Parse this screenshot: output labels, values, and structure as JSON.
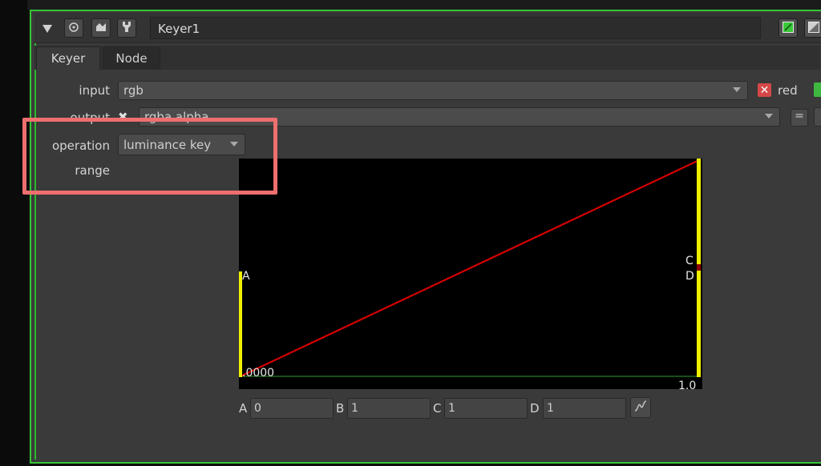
{
  "header": {
    "node_name": "Keyer1",
    "collapse_icon": "triangle-down-icon",
    "icons": [
      "center-node-icon",
      "clone-icon",
      "wrench-icon"
    ],
    "visibility_icons": [
      "green-square-icon",
      "split-square-icon"
    ]
  },
  "tabs": [
    {
      "label": "Keyer",
      "active": true
    },
    {
      "label": "Node",
      "active": false
    }
  ],
  "knobs": {
    "input": {
      "label": "input",
      "value": "rgb",
      "channel_label": "red"
    },
    "output": {
      "label": "output",
      "value": "rgba.alpha",
      "eq_label": "="
    },
    "operation": {
      "label": "operation",
      "value": "luminance key"
    },
    "range": {
      "label": "range"
    }
  },
  "curve": {
    "left_label": "A",
    "right_label_top": "C",
    "right_label_bottom": "D",
    "bottom_left_value": ".0000",
    "bottom_right_value": "1.0",
    "line_color": "#d40000",
    "handle_color": "#f0f000"
  },
  "points": [
    {
      "label": "A",
      "value": "0"
    },
    {
      "label": "B",
      "value": "1"
    },
    {
      "label": "C",
      "value": "1"
    },
    {
      "label": "D",
      "value": "1"
    }
  ],
  "colors": {
    "accent": "#35c635",
    "highlight": "#ef6f6f",
    "panel": "#3a3a3a"
  }
}
